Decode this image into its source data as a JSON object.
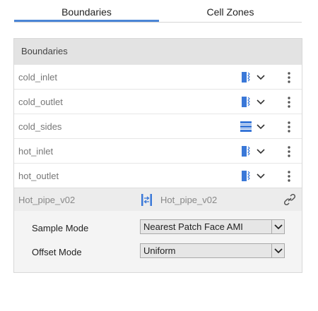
{
  "tabs": [
    {
      "label": "Boundaries"
    },
    {
      "label": "Cell Zones"
    }
  ],
  "panel": {
    "header": "Boundaries",
    "rows": [
      {
        "name": "cold_inlet",
        "type_icon": "patch-icon"
      },
      {
        "name": "cold_outlet",
        "type_icon": "patch-icon"
      },
      {
        "name": "cold_sides",
        "type_icon": "wall-icon"
      },
      {
        "name": "hot_inlet",
        "type_icon": "patch-icon"
      },
      {
        "name": "hot_outlet",
        "type_icon": "patch-icon"
      }
    ],
    "selected": {
      "name": "Hot_pipe_v02",
      "type_icon": "cyclic-ami-icon",
      "neighbour": "Hot_pipe_v02",
      "link_icon": "link-icon"
    },
    "fields": [
      {
        "label": "Sample Mode",
        "value": "Nearest Patch Face AMI"
      },
      {
        "label": "Offset Mode",
        "value": "Uniform"
      }
    ]
  },
  "colors": {
    "accent": "#4b86d6",
    "icon_blue": "#3a78d8"
  }
}
